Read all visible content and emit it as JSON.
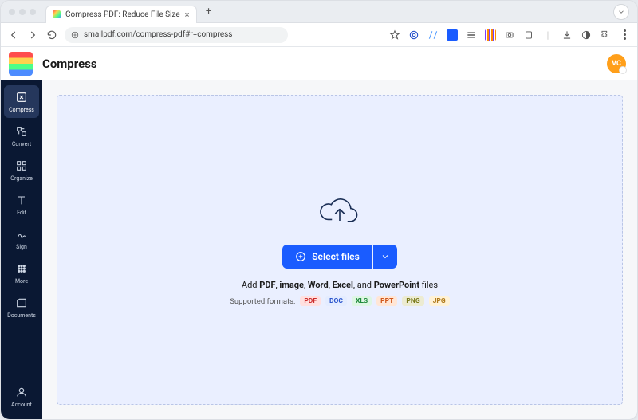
{
  "browser": {
    "tab_title": "Compress PDF: Reduce File Size",
    "url": "smallpdf.com/compress-pdf#r=compress"
  },
  "header": {
    "title": "Compress",
    "avatar_initials": "VC"
  },
  "sidebar": {
    "items": [
      {
        "label": "Compress"
      },
      {
        "label": "Convert"
      },
      {
        "label": "Organize"
      },
      {
        "label": "Edit"
      },
      {
        "label": "Sign"
      },
      {
        "label": "More"
      },
      {
        "label": "Documents"
      }
    ],
    "account_label": "Account"
  },
  "dropzone": {
    "select_label": "Select files",
    "caption_prefix": "Add ",
    "caption_b1": "PDF",
    "caption_sep1": ", ",
    "caption_b2": "image",
    "caption_sep2": ", ",
    "caption_b3": "Word",
    "caption_sep3": ", ",
    "caption_b4": "Excel",
    "caption_sep4": ", and ",
    "caption_b5": "PowerPoint",
    "caption_suffix": " files",
    "supported_label": "Supported formats:",
    "formats": {
      "pdf": "PDF",
      "doc": "DOC",
      "xls": "XLS",
      "ppt": "PPT",
      "png": "PNG",
      "jpg": "JPG"
    }
  }
}
